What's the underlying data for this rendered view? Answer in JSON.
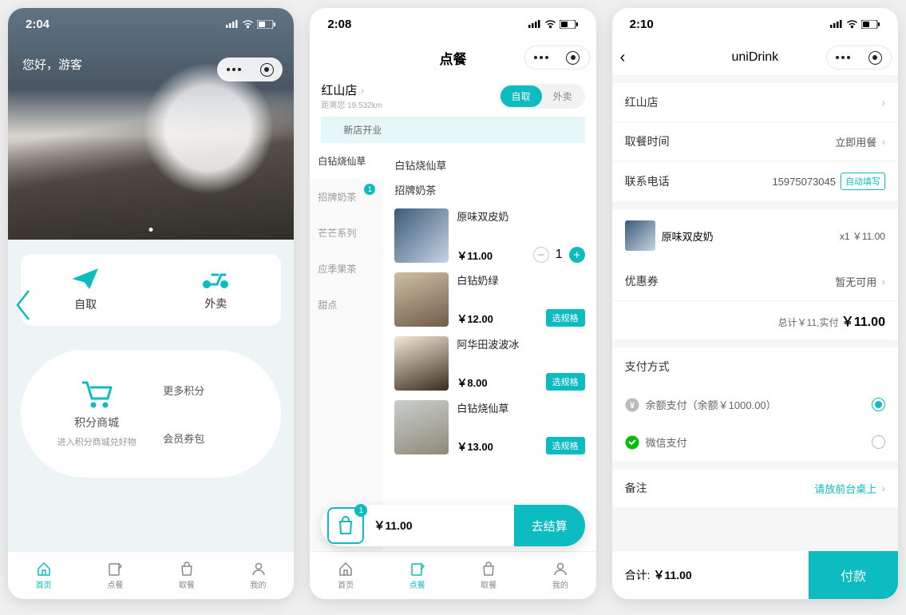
{
  "s1": {
    "time": "2:04",
    "greeting": "您好，游客",
    "pickup": "自取",
    "delivery": "外卖",
    "mall_title": "积分商城",
    "mall_sub": "进入积分商城兑好物",
    "link_points": "更多积分",
    "link_coupon": "会员券包",
    "tabs": [
      "首页",
      "点餐",
      "取餐",
      "我的"
    ]
  },
  "s2": {
    "time": "2:08",
    "title": "点餐",
    "store": "红山店",
    "distance": "距离您 19.532km",
    "mode_pickup": "自取",
    "mode_delivery": "外卖",
    "banner": "新店开业",
    "cats": [
      "白钻烧仙草",
      "招牌奶茶",
      "芒芒系列",
      "应季果茶",
      "甜点"
    ],
    "badge": "1",
    "sec1": "白钻烧仙草",
    "sec2": "招牌奶茶",
    "items": [
      {
        "name": "原味双皮奶",
        "price": "￥11.00",
        "qty": "1"
      },
      {
        "name": "白钻奶绿",
        "price": "￥12.00",
        "spec": "选规格"
      },
      {
        "name": "阿华田波波冰",
        "price": "￥8.00",
        "spec": "选规格"
      },
      {
        "name": "白钻烧仙草",
        "price": "￥13.00",
        "spec": "选规格"
      }
    ],
    "cart_total": "￥11.00",
    "cart_badge": "1",
    "checkout": "去结算",
    "tabs": [
      "首页",
      "点餐",
      "取餐",
      "我的"
    ]
  },
  "s3": {
    "time": "2:10",
    "title": "uniDrink",
    "store_label": "红山店",
    "pickup_label": "取餐时间",
    "pickup_value": "立即用餐",
    "phone_label": "联系电话",
    "phone_value": "15975073045",
    "autofill": "自动填写",
    "item_name": "原味双皮奶",
    "item_qty": "x1",
    "item_price": "￥11.00",
    "coupon_label": "优惠券",
    "coupon_value": "暂无可用",
    "total_prefix": "总计￥11,实付",
    "total": "￥11.00",
    "pay_section": "支付方式",
    "balance": "余额支付（余额￥1000.00）",
    "wechat": "微信支付",
    "note_label": "备注",
    "note_value": "请放前台桌上",
    "footer_label": "合计:",
    "footer_total": "￥11.00",
    "pay_btn": "付款"
  }
}
